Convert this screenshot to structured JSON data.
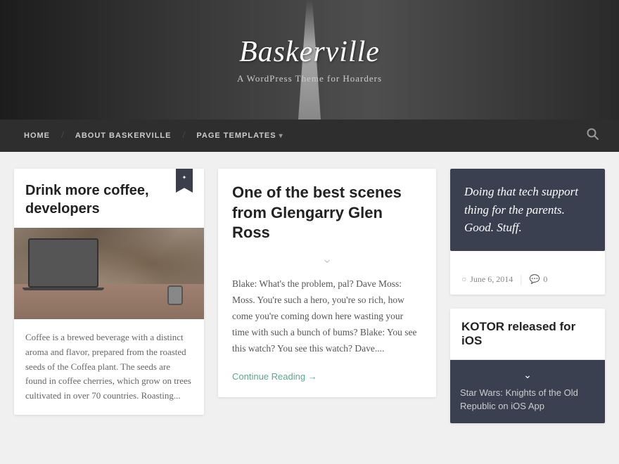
{
  "header": {
    "title": "Baskerville",
    "tagline": "A WordPress Theme for Hoarders",
    "bg_alt": "Road in forest"
  },
  "nav": {
    "items": [
      {
        "label": "HOME",
        "href": "#",
        "has_separator": false
      },
      {
        "label": "ABOUT BASKERVILLE",
        "href": "#",
        "has_separator": true
      },
      {
        "label": "PAGE TEMPLATES",
        "href": "#",
        "has_separator": true,
        "has_arrow": true
      }
    ],
    "search_tooltip": "Search"
  },
  "main": {
    "left_article": {
      "title": "Drink more coffee, developers",
      "image_alt": "Person at laptop with watch",
      "body": "Coffee is a brewed beverage with a distinct aroma and flavor, prepared from the roasted seeds of the Coffea plant. The seeds are found in coffee cherries, which grow on trees cultivated in over 70 countries. Roasting..."
    },
    "middle_article": {
      "title": "One of the best scenes from Glengarry Glen Ross",
      "body": "Blake: What's the problem, pal? Dave Moss: Moss. You're such a hero, you're so rich, how come you're coming down here wasting your time with such a bunch of bums? Blake: You see this watch? You see this watch? Dave....",
      "continue_reading": "Continue Reading →"
    },
    "right_sidebar": {
      "quote": {
        "text": "Doing that tech support thing for the parents. Good. Stuff.",
        "date": "June 6, 2014",
        "comments": "0"
      },
      "article": {
        "title": "KOTOR released for iOS",
        "subtitle": "Star Wars: Knights of the Old Republic on iOS App"
      }
    }
  }
}
